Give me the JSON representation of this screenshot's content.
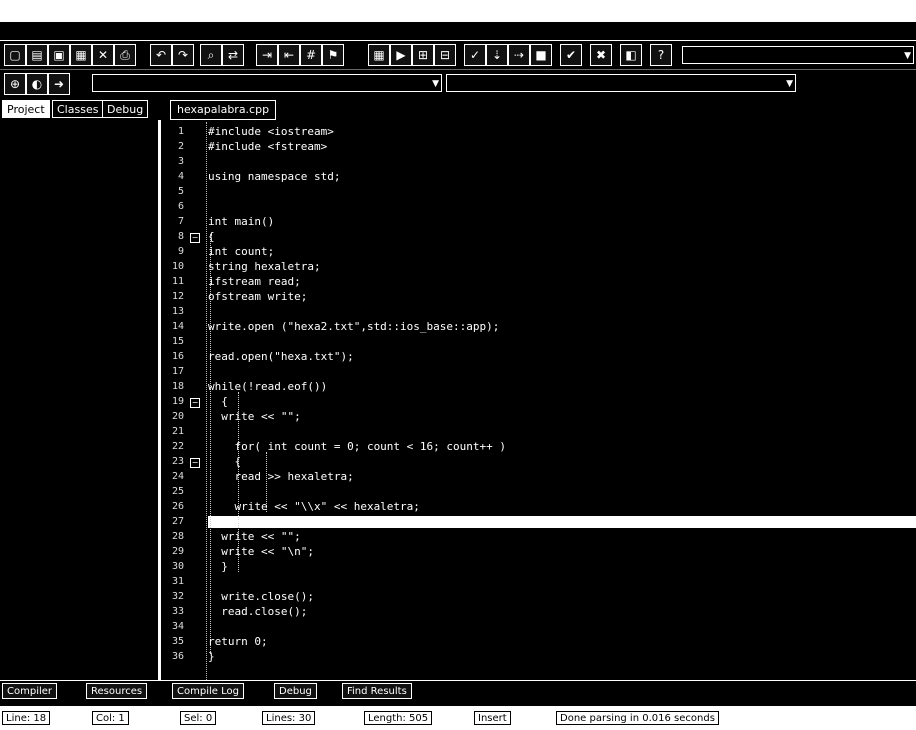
{
  "file_tab": "hexapalabra.cpp",
  "panel_tabs": [
    "Project",
    "Classes",
    "Debug"
  ],
  "status": {
    "line": "Line: 18",
    "col": "Col: 1",
    "sel": "Sel: 0",
    "lines": "Lines: 30",
    "length": "Length: 505",
    "mode": "Insert",
    "message": "Done parsing in 0.016 seconds"
  },
  "bottom_tabs": [
    "Compiler",
    "Resources",
    "Compile Log",
    "Debug",
    "Find Results"
  ],
  "code_lines": [
    "#include <iostream>",
    "#include <fstream>",
    "",
    "using namespace std;",
    "",
    "",
    "int main()",
    "{",
    "int count;",
    "string hexaletra;",
    "ifstream read;",
    "ofstream write;",
    "",
    "write.open (\"hexa2.txt\",std::ios_base::app);",
    "",
    "read.open(\"hexa.txt\");",
    "",
    "while(!read.eof())",
    "  {",
    "  write << \"\";",
    "",
    "    for( int count = 0; count < 16; count++ )",
    "    {",
    "    read >> hexaletra;",
    "",
    "    write << \"\\\\x\" << hexaletra;",
    "    }",
    "  write << \"\";",
    "  write << \"\\n\";",
    "  }",
    "",
    "  write.close();",
    "  read.close();",
    "",
    "return 0;",
    "}"
  ],
  "line_numbers": [
    "1",
    "2",
    "3",
    "4",
    "5",
    "6",
    "7",
    "8",
    "9",
    "10",
    "11",
    "12",
    "13",
    "14",
    "15",
    "16",
    "17",
    "18",
    "19",
    "20",
    "21",
    "22",
    "23",
    "24",
    "25",
    "26",
    "27",
    "28",
    "29",
    "30",
    "31",
    "32",
    "33",
    "34",
    "35",
    "36"
  ]
}
